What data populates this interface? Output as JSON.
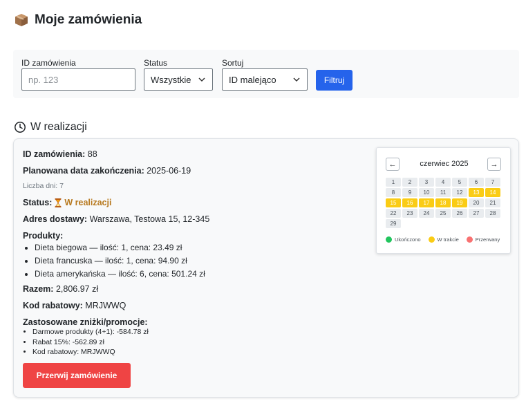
{
  "page": {
    "title": "Moje zamówienia"
  },
  "filters": {
    "order_id_label": "ID zamówienia",
    "order_id_placeholder": "np. 123",
    "order_id_value": "",
    "status_label": "Status",
    "status_value": "Wszystkie",
    "sort_label": "Sortuj",
    "sort_value": "ID malejąco",
    "filter_button": "Filtruj",
    "accent_color": "#2563eb"
  },
  "section": {
    "title": "W realizacji"
  },
  "order": {
    "id_label": "ID zamówienia:",
    "id_value": "88",
    "end_date_label": "Planowana data zakończenia:",
    "end_date_value": "2025-06-19",
    "days_count": "Liczba dni: 7",
    "status_label": "Status:",
    "status_value": "W realizacji",
    "address_label": "Adres dostawy:",
    "address_value": "Warszawa, Testowa 15, 12-345",
    "products_label": "Produkty:",
    "products": [
      "Dieta biegowa — ilość: 1, cena: 23.49 zł",
      "Dieta francuska — ilość: 1, cena: 94.90 zł",
      "Dieta amerykańska — ilość: 6, cena: 501.24 zł"
    ],
    "total_label": "Razem:",
    "total_value": "2,806.97 zł",
    "discount_code_label": "Kod rabatowy:",
    "discount_code_value": "MRJWWQ",
    "promos_label": "Zastosowane zniżki/promocje:",
    "promos": [
      "Darmowe produkty (4+1): -584.78 zł",
      "Rabat 15%: -562.89 zł",
      "Kod rabatowy: MRJWWQ"
    ],
    "abort_button": "Przerwij zamówienie",
    "abort_color": "#ef4444"
  },
  "calendar": {
    "prev": "←",
    "next": "→",
    "title": "czerwiec 2025",
    "days": [
      "1",
      "2",
      "3",
      "4",
      "5",
      "6",
      "7",
      "8",
      "9",
      "10",
      "11",
      "12",
      "13",
      "14",
      "15",
      "16",
      "17",
      "18",
      "19",
      "20",
      "21",
      "22",
      "23",
      "24",
      "25",
      "26",
      "27",
      "28",
      "29"
    ],
    "in_progress_days": [
      "13",
      "14",
      "15",
      "16",
      "17",
      "18",
      "19"
    ],
    "legend": [
      {
        "label": "Ukończono",
        "color": "#22c55e"
      },
      {
        "label": "W trakcie",
        "color": "#facc15"
      },
      {
        "label": "Przerwany",
        "color": "#f87171"
      }
    ]
  }
}
